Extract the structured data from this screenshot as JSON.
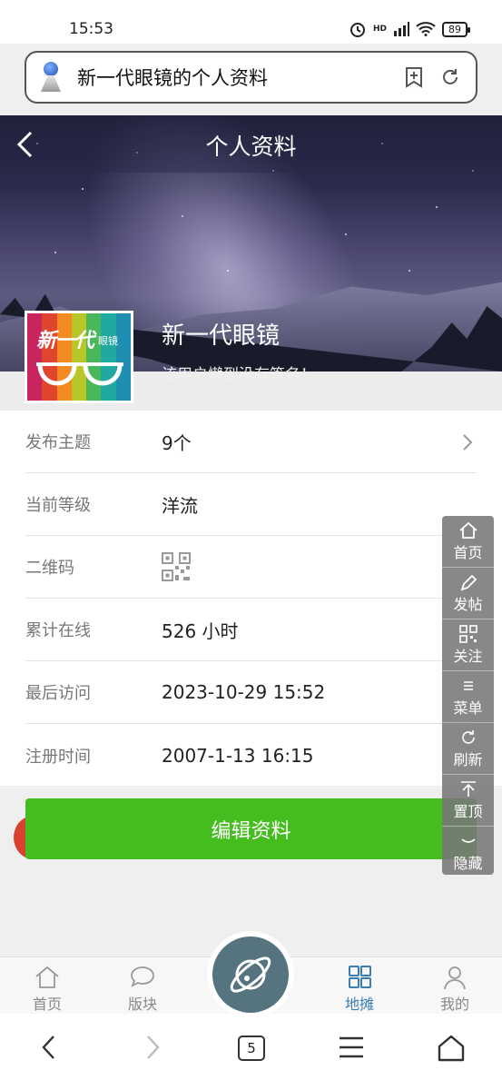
{
  "status_bar": {
    "time": "15:53",
    "network": "HD",
    "battery": "89"
  },
  "browser": {
    "page_title": "新一代眼镜的个人资料",
    "tab_count": "5"
  },
  "header": {
    "title": "个人资料"
  },
  "profile": {
    "name": "新一代眼镜",
    "signature": "该用户懒到没有签名！",
    "avatar_brand": "新一代",
    "avatar_brand_sub": "眼镜"
  },
  "info": [
    {
      "label": "发布主题",
      "value": "9个"
    },
    {
      "label": "当前等级",
      "value": "洋流"
    },
    {
      "label": "二维码",
      "value": ""
    },
    {
      "label": "累计在线",
      "value": "526 小时"
    },
    {
      "label": "最后访问",
      "value": "2023-10-29 15:52"
    },
    {
      "label": "注册时间",
      "value": "2007-1-13 16:15"
    }
  ],
  "edit_button": "编辑资料",
  "float_menu": [
    "首页",
    "发帖",
    "关注",
    "菜单",
    "刷新",
    "置顶",
    "隐藏"
  ],
  "tabs": [
    "首页",
    "版块",
    "地摊",
    "我的"
  ],
  "colors": {
    "accent_green": "#45bd1f",
    "tab_active": "#3b7db3",
    "center_button": "#557480"
  }
}
